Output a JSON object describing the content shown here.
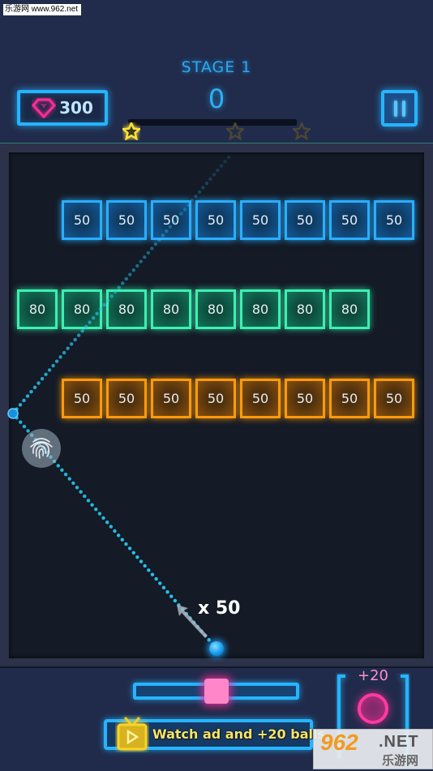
{
  "watermark": {
    "top_text": "乐游网 www.962.net",
    "logo_number": "962",
    "logo_suffix": ".NET",
    "logo_cn": "乐游网"
  },
  "header": {
    "stage_label": "STAGE 1",
    "score": "0",
    "gems": "300",
    "pause_icon": "pause-icon",
    "stars_earned": 1,
    "stars_total": 3,
    "progress": 0
  },
  "rows": [
    {
      "color": "blue",
      "start_col": 1,
      "values": [
        "50",
        "50",
        "50",
        "50",
        "50",
        "50",
        "50",
        "50"
      ]
    },
    {
      "color": "green",
      "start_col": 0,
      "values": [
        "80",
        "80",
        "80",
        "80",
        "80",
        "80",
        "80",
        "80"
      ]
    },
    {
      "color": "orange",
      "start_col": 1,
      "values": [
        "50",
        "50",
        "50",
        "50",
        "50",
        "50",
        "50",
        "50"
      ]
    }
  ],
  "launcher": {
    "ball_count": "x 50",
    "hint_icon": "fingerprint-icon"
  },
  "bottom": {
    "speed_slider_value": 0.5,
    "ad_button_label": "Watch ad and +20 balls",
    "ad_icon": "tv-icon",
    "bonus_label": "+20",
    "bonus_icon": "ball-ring-icon"
  },
  "colors": {
    "blue": "#2aaeff",
    "green": "#3cf0b0",
    "orange": "#ff9a0a",
    "pink": "#ff2c96",
    "yellow": "#f6e46a",
    "background": "#212b4b",
    "play_area": "#141a26"
  }
}
